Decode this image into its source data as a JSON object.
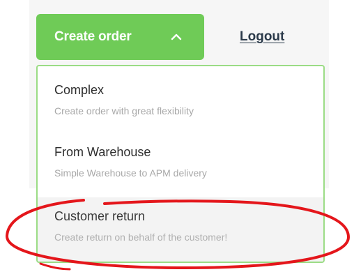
{
  "header": {
    "create_order_label": "Create order",
    "logout_label": "Logout"
  },
  "dropdown": {
    "items": [
      {
        "title": "Complex",
        "description": "Create order with great flexibility"
      },
      {
        "title": "From Warehouse",
        "description": "Simple Warehouse to APM delivery"
      },
      {
        "title": "Customer return",
        "description": "Create return on behalf of the customer!"
      }
    ]
  },
  "colors": {
    "button_green": "#6fcb57",
    "dropdown_border": "#9bdc85",
    "annotation_red": "#e4161b"
  },
  "icons": {
    "create_order_toggle": "chevron-up-icon"
  }
}
